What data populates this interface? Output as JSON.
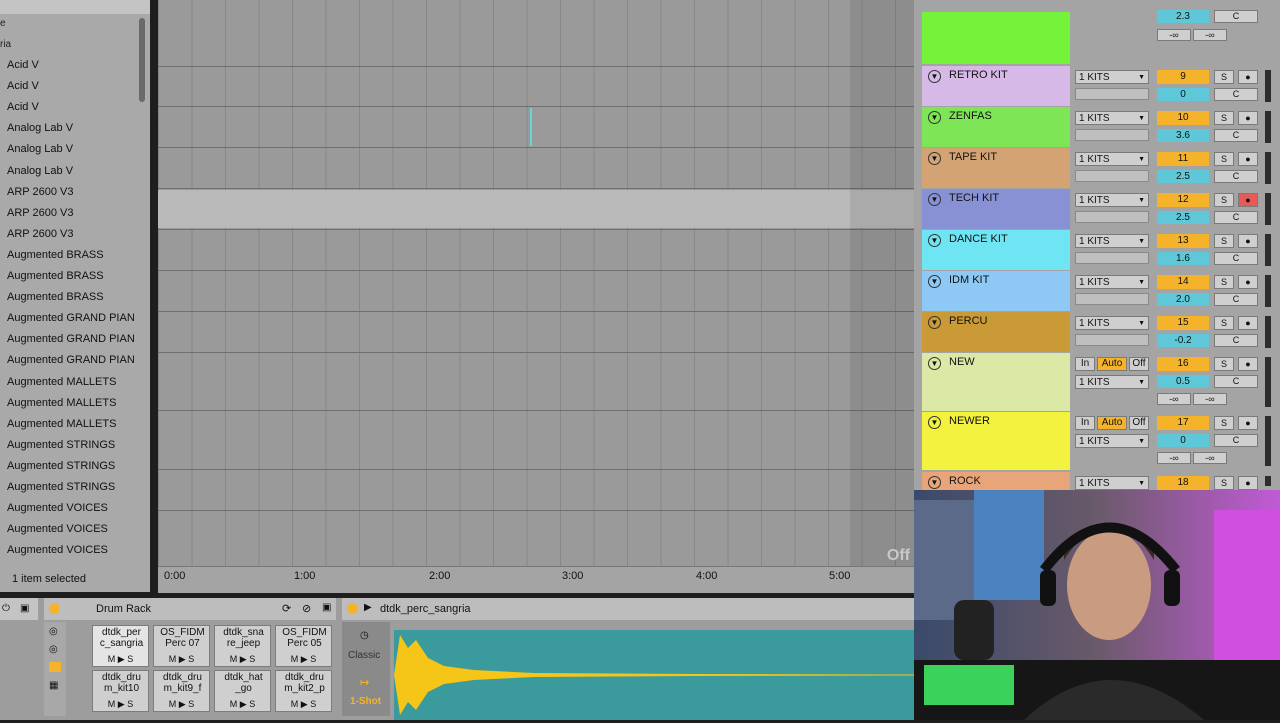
{
  "browser": {
    "tiny": [
      "e",
      "ria"
    ],
    "items": [
      "Acid V",
      "Acid V",
      "Acid V",
      "Analog Lab V",
      "Analog Lab V",
      "Analog Lab V",
      "ARP 2600 V3",
      "ARP 2600 V3",
      "ARP 2600 V3",
      "Augmented BRASS",
      "Augmented BRASS",
      "Augmented BRASS",
      "Augmented GRAND PIAN",
      "Augmented GRAND PIAN",
      "Augmented GRAND PIAN",
      "Augmented MALLETS",
      "Augmented MALLETS",
      "Augmented MALLETS",
      "Augmented STRINGS",
      "Augmented STRINGS",
      "Augmented STRINGS",
      "Augmented VOICES",
      "Augmented VOICES",
      "Augmented VOICES"
    ],
    "status": "1 item selected"
  },
  "arrangement": {
    "off_label": "Off",
    "ruler": [
      "0:00",
      "1:00",
      "2:00",
      "3:00",
      "4:00",
      "5:00"
    ]
  },
  "mixer": {
    "top_vol": "2.3",
    "top_pan": "C",
    "top_inf": [
      "-∞",
      "-∞"
    ],
    "tracks": [
      {
        "name": "RETRO KIT",
        "color": "#d7b9e8",
        "kits": "1 KITS",
        "num": "9",
        "vol": "0",
        "pan": "C",
        "solo": "S",
        "arm": "●"
      },
      {
        "name": "ZENFAS",
        "color": "#7ee557",
        "kits": "1 KITS",
        "num": "10",
        "vol": "3.6",
        "pan": "C",
        "solo": "S",
        "arm": "●"
      },
      {
        "name": "TAPE KIT",
        "color": "#d4a373",
        "kits": "1 KITS",
        "num": "11",
        "vol": "2.5",
        "pan": "C",
        "solo": "S",
        "arm": "●"
      },
      {
        "name": "TECH KIT",
        "color": "#8791d4",
        "kits": "1 KITS",
        "num": "12",
        "vol": "2.5",
        "pan": "C",
        "solo": "S",
        "arm": "●"
      },
      {
        "name": "DANCE KIT",
        "color": "#6fe4f2",
        "kits": "1 KITS",
        "num": "13",
        "vol": "1.6",
        "pan": "C",
        "solo": "S",
        "arm": "●"
      },
      {
        "name": "IDM KIT",
        "color": "#8ec9f5",
        "kits": "1 KITS",
        "num": "14",
        "vol": "2.0",
        "pan": "C",
        "solo": "S",
        "arm": "●"
      },
      {
        "name": "PERCU",
        "color": "#c99a35",
        "kits": "1 KITS",
        "num": "15",
        "vol": "-0.2",
        "pan": "C",
        "solo": "S",
        "arm": "●"
      },
      {
        "name": "NEW",
        "color": "#dbe8a6",
        "kits": "1 KITS",
        "num": "16",
        "vol": "0.5",
        "pan": "C",
        "solo": "S",
        "arm": "●",
        "in": "In",
        "auto": "Auto",
        "off": "Off",
        "inf": [
          "-∞",
          "-∞"
        ]
      },
      {
        "name": "NEWER",
        "color": "#f3f23e",
        "kits": "1 KITS",
        "num": "17",
        "vol": "0",
        "pan": "C",
        "solo": "S",
        "arm": "●",
        "in": "In",
        "auto": "Auto",
        "off": "Off",
        "inf": [
          "-∞",
          "-∞"
        ]
      },
      {
        "name": "ROCK",
        "color": "#e8a57a",
        "kits": "1 KITS",
        "num": "18",
        "solo": "S",
        "arm": "●"
      }
    ]
  },
  "device": {
    "rack_title": "Drum Rack",
    "sample_title": "dtdk_perc_sangria",
    "mode_classic": "Classic",
    "mode_oneshot": "1-Shot",
    "pads": [
      {
        "name": "dtdk_per\nc_sangria",
        "m": "M",
        "s": "S"
      },
      {
        "name": "OS_FIDM\nPerc 07",
        "m": "M",
        "s": "S"
      },
      {
        "name": "dtdk_sna\nre_jeep",
        "m": "M",
        "s": "S"
      },
      {
        "name": "OS_FIDM\nPerc 05",
        "m": "M",
        "s": "S"
      },
      {
        "name": "dtdk_dru\nm_kit10",
        "m": "M",
        "s": "S"
      },
      {
        "name": "dtdk_dru\nm_kit9_f",
        "m": "M",
        "s": "S"
      },
      {
        "name": "dtdk_hat\n_go",
        "m": "M",
        "s": "S"
      },
      {
        "name": "dtdk_dru\nm_kit2_p",
        "m": "M",
        "s": "S"
      }
    ]
  }
}
